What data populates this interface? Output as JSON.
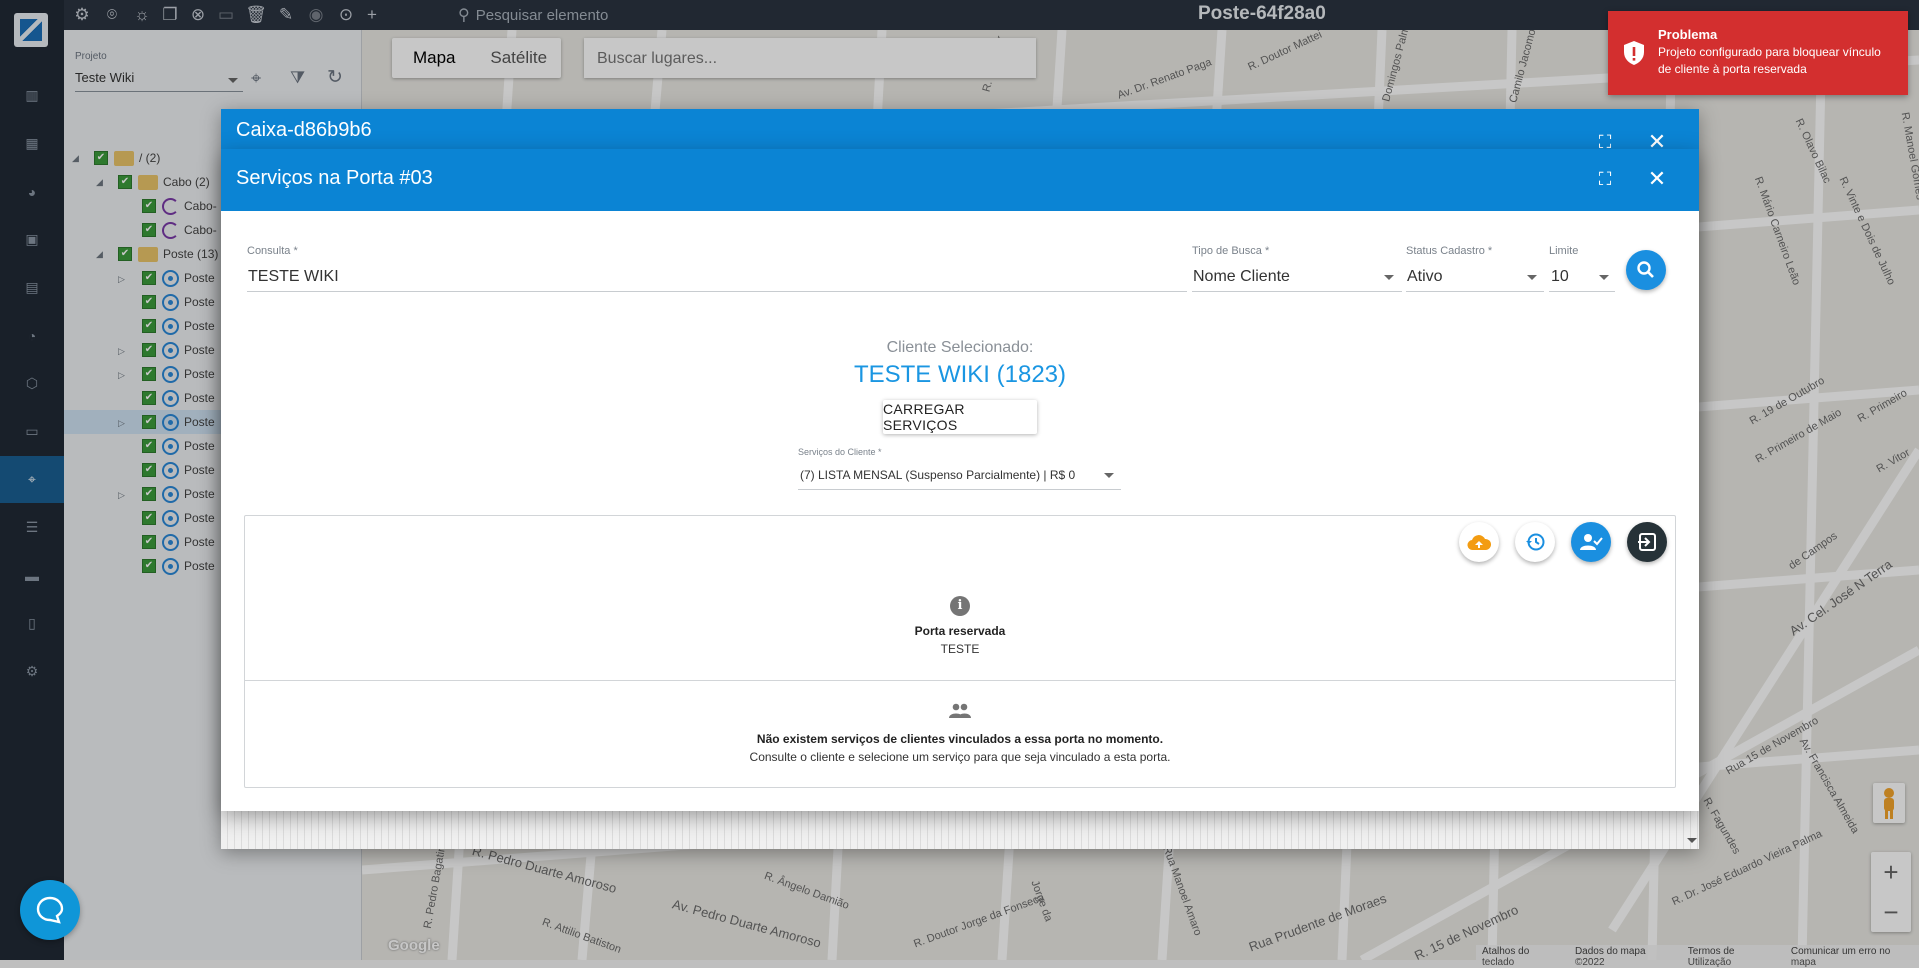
{
  "topbar": {
    "search_placeholder": "Pesquisar elemento",
    "title": "Poste-64f28a0"
  },
  "left_panel": {
    "project_label": "Projeto",
    "project_value": "Teste Wiki",
    "tree": [
      {
        "label": "/ (2)",
        "type": "folder"
      },
      {
        "label": "Cabo (2)",
        "type": "folder"
      },
      {
        "label": "Cabo-",
        "type": "cabo"
      },
      {
        "label": "Cabo-",
        "type": "cabo"
      },
      {
        "label": "Poste (13)",
        "type": "folder"
      },
      {
        "label": "Poste",
        "type": "poste"
      },
      {
        "label": "Poste",
        "type": "poste"
      },
      {
        "label": "Poste",
        "type": "poste"
      },
      {
        "label": "Poste",
        "type": "poste"
      },
      {
        "label": "Poste",
        "type": "poste"
      },
      {
        "label": "Poste",
        "type": "poste"
      },
      {
        "label": "Poste",
        "type": "poste"
      },
      {
        "label": "Poste",
        "type": "poste"
      },
      {
        "label": "Poste",
        "type": "poste"
      },
      {
        "label": "Poste",
        "type": "poste"
      },
      {
        "label": "Poste",
        "type": "poste"
      },
      {
        "label": "Poste",
        "type": "poste"
      },
      {
        "label": "Poste",
        "type": "poste"
      }
    ]
  },
  "map": {
    "tab_map": "Mapa",
    "tab_satellite": "Satélite",
    "search_placeholder": "Buscar lugares...",
    "streets": [
      "Av. Dr. Renato Paga",
      "R. Manoel Gomes",
      "R. Olavo Bilac",
      "R. Vinte e Dois de Julho",
      "R. Mário Carneiro Leão",
      "R. 19 de Outubro",
      "R. Primeiro de Maio",
      "R. Primeiro",
      "Av. Cel. José N Terra",
      "Rua 15 de Novembro",
      "Av. Francisca Almeida",
      "R. Dr. José Eduardo Vieira Palma",
      "Rua Prudente de Moraes",
      "R. 15 de Novembro",
      "R. Pedro Duarte Amoroso",
      "Av. Pedro Duarte Amoroso",
      "R. Ângelo Damião",
      "R. Attilio Batiston",
      "R. Doutor Jorge da Fonseca",
      "Rua Manoel Amaro",
      "R. Pedro Bagatini",
      "R. Fagundes",
      "de Campos",
      "R. Vitor",
      "Jorge da",
      "R. Salvador",
      "Domingos Palma",
      "R. Doutor Mattei",
      "Camilo Jacomo"
    ],
    "attribution": [
      "Atalhos do teclado",
      "Dados do mapa ©2022",
      "Termos de Utilização",
      "Comunicar um erro no mapa"
    ],
    "google": "Google"
  },
  "back_dialog": {
    "title": "Caixa-d86b9b6"
  },
  "dialog": {
    "title": "Serviços na Porta #03",
    "consulta_label": "Consulta *",
    "consulta_value": "TESTE WIKI",
    "tipo_label": "Tipo de Busca *",
    "tipo_value": "Nome Cliente",
    "status_label": "Status Cadastro *",
    "status_value": "Ativo",
    "limite_label": "Limite",
    "limite_value": "10",
    "cliente_label": "Cliente Selecionado:",
    "cliente_name": "TESTE WIKI (1823)",
    "load_button": "CARREGAR SERVIÇOS",
    "servicos_label": "Serviços do Cliente *",
    "servicos_value": "(7) LISTA MENSAL (Suspenso Parcialmente) | R$ 0",
    "reserved_title": "Porta reservada",
    "reserved_sub": "TESTE",
    "empty_title": "Não existem serviços de clientes vinculados a essa porta no momento.",
    "empty_sub": "Consulte o cliente e selecione um serviço para que seja vinculado a esta porta."
  },
  "toast": {
    "title": "Problema",
    "message": "Projeto configurado para bloquear vínculo de cliente à porta reservada",
    "color": "#d32f2f"
  },
  "colors": {
    "accent": "#0b84d4",
    "sidebar": "#212a35",
    "client_name": "#1a96e2"
  }
}
